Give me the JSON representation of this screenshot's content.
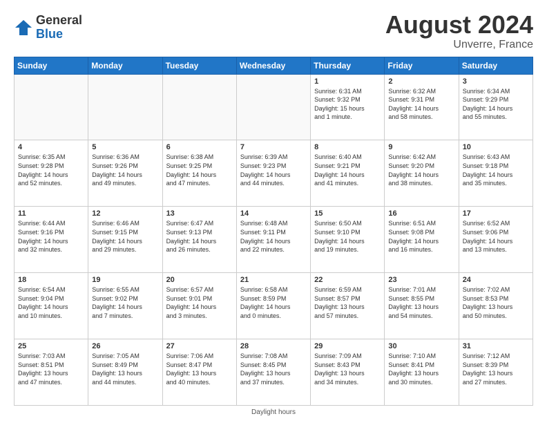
{
  "logo": {
    "general": "General",
    "blue": "Blue"
  },
  "title": "August 2024",
  "location": "Unverre, France",
  "footer": "Daylight hours",
  "headers": [
    "Sunday",
    "Monday",
    "Tuesday",
    "Wednesday",
    "Thursday",
    "Friday",
    "Saturday"
  ],
  "weeks": [
    [
      {
        "day": "",
        "info": ""
      },
      {
        "day": "",
        "info": ""
      },
      {
        "day": "",
        "info": ""
      },
      {
        "day": "",
        "info": ""
      },
      {
        "day": "1",
        "info": "Sunrise: 6:31 AM\nSunset: 9:32 PM\nDaylight: 15 hours\nand 1 minute."
      },
      {
        "day": "2",
        "info": "Sunrise: 6:32 AM\nSunset: 9:31 PM\nDaylight: 14 hours\nand 58 minutes."
      },
      {
        "day": "3",
        "info": "Sunrise: 6:34 AM\nSunset: 9:29 PM\nDaylight: 14 hours\nand 55 minutes."
      }
    ],
    [
      {
        "day": "4",
        "info": "Sunrise: 6:35 AM\nSunset: 9:28 PM\nDaylight: 14 hours\nand 52 minutes."
      },
      {
        "day": "5",
        "info": "Sunrise: 6:36 AM\nSunset: 9:26 PM\nDaylight: 14 hours\nand 49 minutes."
      },
      {
        "day": "6",
        "info": "Sunrise: 6:38 AM\nSunset: 9:25 PM\nDaylight: 14 hours\nand 47 minutes."
      },
      {
        "day": "7",
        "info": "Sunrise: 6:39 AM\nSunset: 9:23 PM\nDaylight: 14 hours\nand 44 minutes."
      },
      {
        "day": "8",
        "info": "Sunrise: 6:40 AM\nSunset: 9:21 PM\nDaylight: 14 hours\nand 41 minutes."
      },
      {
        "day": "9",
        "info": "Sunrise: 6:42 AM\nSunset: 9:20 PM\nDaylight: 14 hours\nand 38 minutes."
      },
      {
        "day": "10",
        "info": "Sunrise: 6:43 AM\nSunset: 9:18 PM\nDaylight: 14 hours\nand 35 minutes."
      }
    ],
    [
      {
        "day": "11",
        "info": "Sunrise: 6:44 AM\nSunset: 9:16 PM\nDaylight: 14 hours\nand 32 minutes."
      },
      {
        "day": "12",
        "info": "Sunrise: 6:46 AM\nSunset: 9:15 PM\nDaylight: 14 hours\nand 29 minutes."
      },
      {
        "day": "13",
        "info": "Sunrise: 6:47 AM\nSunset: 9:13 PM\nDaylight: 14 hours\nand 26 minutes."
      },
      {
        "day": "14",
        "info": "Sunrise: 6:48 AM\nSunset: 9:11 PM\nDaylight: 14 hours\nand 22 minutes."
      },
      {
        "day": "15",
        "info": "Sunrise: 6:50 AM\nSunset: 9:10 PM\nDaylight: 14 hours\nand 19 minutes."
      },
      {
        "day": "16",
        "info": "Sunrise: 6:51 AM\nSunset: 9:08 PM\nDaylight: 14 hours\nand 16 minutes."
      },
      {
        "day": "17",
        "info": "Sunrise: 6:52 AM\nSunset: 9:06 PM\nDaylight: 14 hours\nand 13 minutes."
      }
    ],
    [
      {
        "day": "18",
        "info": "Sunrise: 6:54 AM\nSunset: 9:04 PM\nDaylight: 14 hours\nand 10 minutes."
      },
      {
        "day": "19",
        "info": "Sunrise: 6:55 AM\nSunset: 9:02 PM\nDaylight: 14 hours\nand 7 minutes."
      },
      {
        "day": "20",
        "info": "Sunrise: 6:57 AM\nSunset: 9:01 PM\nDaylight: 14 hours\nand 3 minutes."
      },
      {
        "day": "21",
        "info": "Sunrise: 6:58 AM\nSunset: 8:59 PM\nDaylight: 14 hours\nand 0 minutes."
      },
      {
        "day": "22",
        "info": "Sunrise: 6:59 AM\nSunset: 8:57 PM\nDaylight: 13 hours\nand 57 minutes."
      },
      {
        "day": "23",
        "info": "Sunrise: 7:01 AM\nSunset: 8:55 PM\nDaylight: 13 hours\nand 54 minutes."
      },
      {
        "day": "24",
        "info": "Sunrise: 7:02 AM\nSunset: 8:53 PM\nDaylight: 13 hours\nand 50 minutes."
      }
    ],
    [
      {
        "day": "25",
        "info": "Sunrise: 7:03 AM\nSunset: 8:51 PM\nDaylight: 13 hours\nand 47 minutes."
      },
      {
        "day": "26",
        "info": "Sunrise: 7:05 AM\nSunset: 8:49 PM\nDaylight: 13 hours\nand 44 minutes."
      },
      {
        "day": "27",
        "info": "Sunrise: 7:06 AM\nSunset: 8:47 PM\nDaylight: 13 hours\nand 40 minutes."
      },
      {
        "day": "28",
        "info": "Sunrise: 7:08 AM\nSunset: 8:45 PM\nDaylight: 13 hours\nand 37 minutes."
      },
      {
        "day": "29",
        "info": "Sunrise: 7:09 AM\nSunset: 8:43 PM\nDaylight: 13 hours\nand 34 minutes."
      },
      {
        "day": "30",
        "info": "Sunrise: 7:10 AM\nSunset: 8:41 PM\nDaylight: 13 hours\nand 30 minutes."
      },
      {
        "day": "31",
        "info": "Sunrise: 7:12 AM\nSunset: 8:39 PM\nDaylight: 13 hours\nand 27 minutes."
      }
    ]
  ]
}
